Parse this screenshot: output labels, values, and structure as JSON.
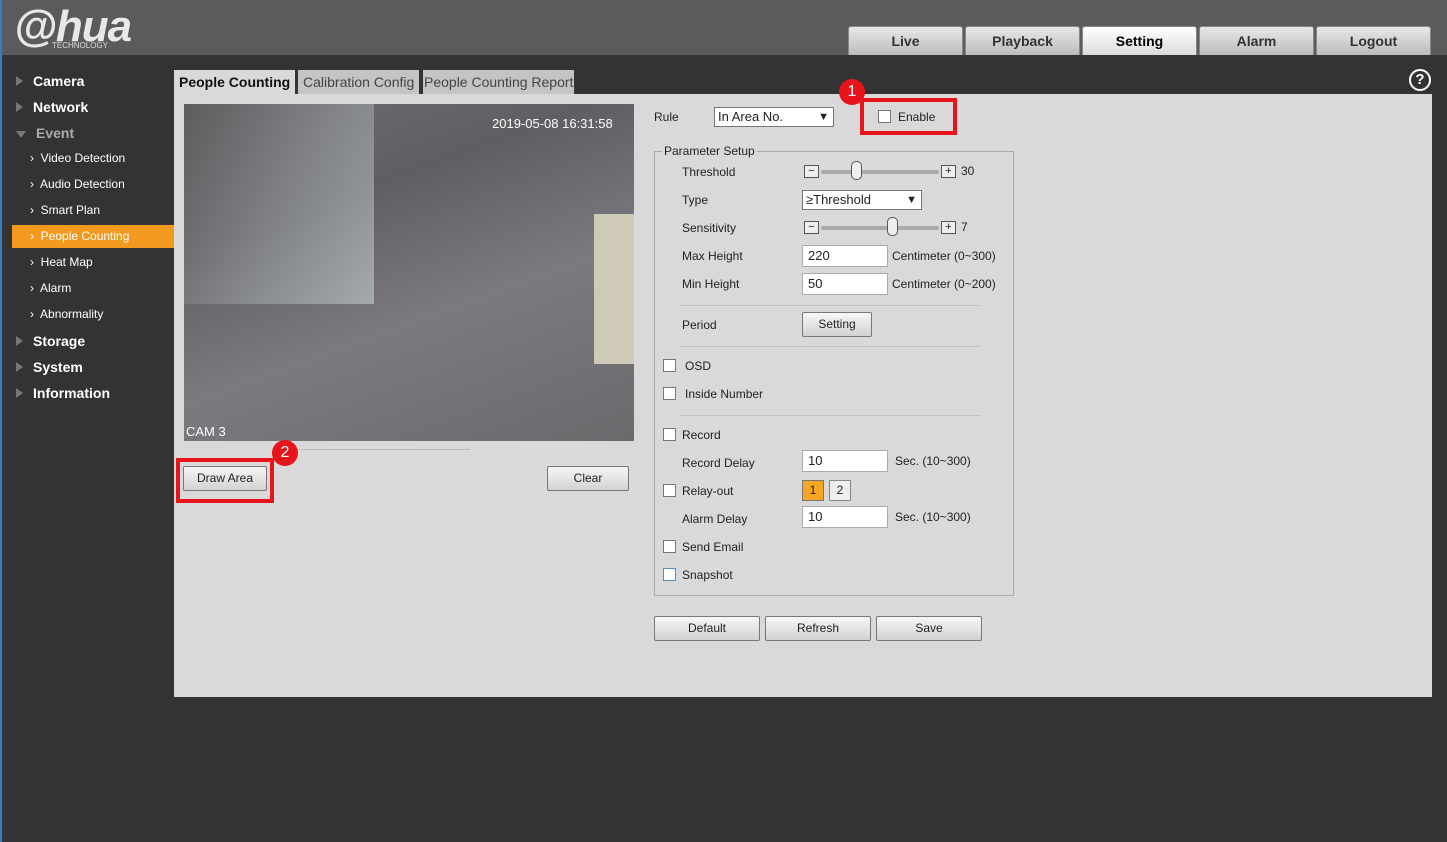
{
  "header": {
    "logo": "alhua",
    "logo_sub": "TECHNOLOGY",
    "nav": [
      "Live",
      "Playback",
      "Setting",
      "Alarm",
      "Logout"
    ],
    "active_nav": "Setting"
  },
  "sidebar": {
    "main": [
      "Camera",
      "Network",
      "Event",
      "Storage",
      "System",
      "Information"
    ],
    "sub": [
      "Video Detection",
      "Audio Detection",
      "Smart Plan",
      "People Counting",
      "Heat Map",
      "Alarm",
      "Abnormality"
    ],
    "active": "People Counting"
  },
  "tabs": [
    "People Counting",
    "Calibration Config",
    "People Counting Report"
  ],
  "video": {
    "timestamp": "2019-05-08 16:31:58",
    "camera": "CAM 3"
  },
  "buttons": {
    "draw_area": "Draw Area",
    "clear": "Clear",
    "default": "Default",
    "refresh": "Refresh",
    "save": "Save",
    "setting": "Setting"
  },
  "annotations": [
    "1",
    "2"
  ],
  "form": {
    "rule_label": "Rule",
    "rule_value": "In Area No.",
    "enable_label": "Enable",
    "param_setup": "Parameter Setup",
    "threshold_label": "Threshold",
    "threshold_value": "30",
    "threshold_fraction": 0.3,
    "type_label": "Type",
    "type_value": "≥Threshold",
    "sensitivity_label": "Sensitivity",
    "sensitivity_value": "7",
    "sensitivity_fraction": 0.6,
    "max_height_label": "Max Height",
    "max_height": "220",
    "max_height_unit": "Centimeter (0~300)",
    "min_height_label": "Min Height",
    "min_height": "50",
    "min_height_unit": "Centimeter (0~200)",
    "period_label": "Period",
    "osd_label": "OSD",
    "inside_label": "Inside Number",
    "record_label": "Record",
    "record_delay_label": "Record Delay",
    "record_delay": "10",
    "record_delay_unit": "Sec. (10~300)",
    "relay_label": "Relay-out",
    "relay_options": [
      "1",
      "2"
    ],
    "alarm_delay_label": "Alarm Delay",
    "alarm_delay": "10",
    "alarm_delay_unit": "Sec. (10~300)",
    "email_label": "Send Email",
    "snapshot_label": "Snapshot"
  },
  "help": "?"
}
